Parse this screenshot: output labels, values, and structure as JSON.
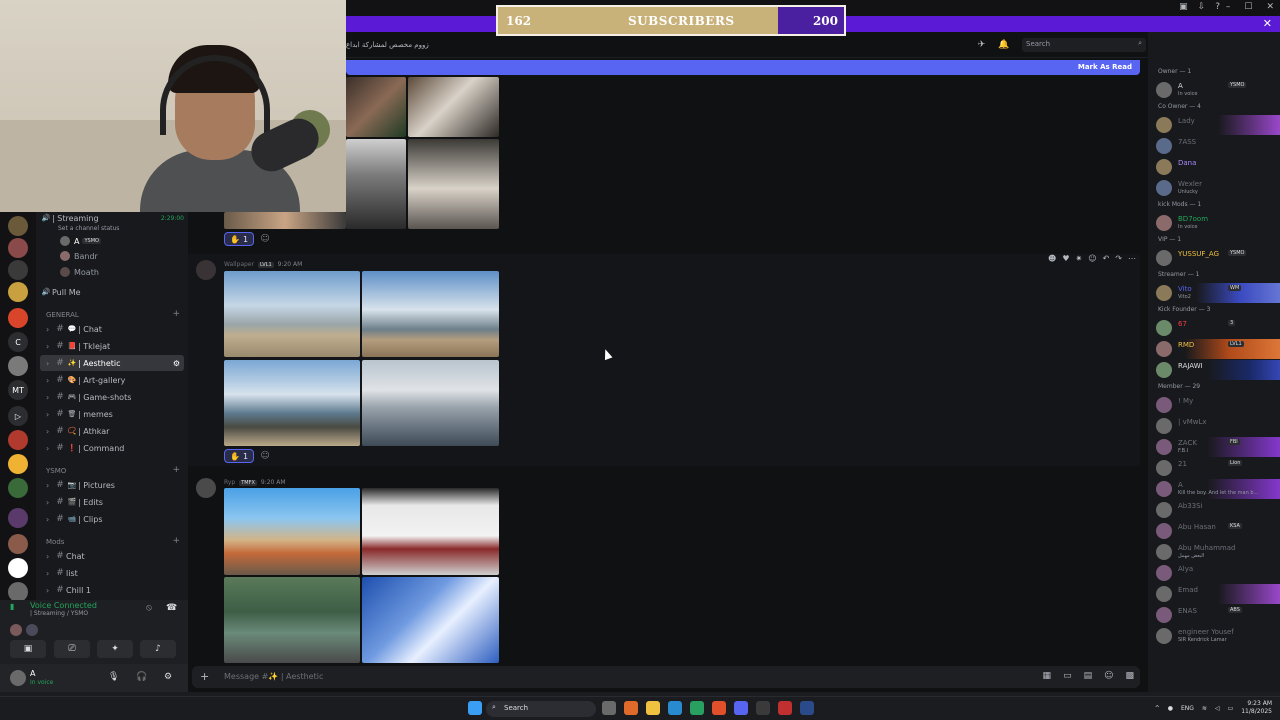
{
  "overlay": {
    "current": "162",
    "label": "SUBSCRIBERS",
    "goal": "200",
    "progress": 0.81
  },
  "sidebar": {
    "voice_channel": "| Streaming",
    "voice_time": "2:29:00",
    "status_line": "Set a channel status",
    "voice_users": [
      "A",
      "Bandr",
      "Moath"
    ],
    "voice_user_badge": "YSMO",
    "pull_me": "Pull Me",
    "cat_general": "GENERAL",
    "general_channels": [
      {
        "name": "| Chat",
        "emoji": "💬"
      },
      {
        "name": "| Tklejat",
        "emoji": "📕"
      },
      {
        "name": "| Aesthetic",
        "emoji": "✨"
      },
      {
        "name": "| Art-gallery",
        "emoji": "🎨"
      },
      {
        "name": "| Game-shots",
        "emoji": "🎮"
      },
      {
        "name": "| memes",
        "emoji": "🗑"
      },
      {
        "name": "| Athkar",
        "emoji": "📿"
      },
      {
        "name": "| Command",
        "emoji": "❗"
      }
    ],
    "cat_ysmo": "YSMO",
    "ysmo_channels": [
      {
        "name": "| Pictures",
        "emoji": "📷"
      },
      {
        "name": "| Edits",
        "emoji": "🎬"
      },
      {
        "name": "| Clips",
        "emoji": "📹"
      }
    ],
    "cat_mods": "Mods",
    "mods_channels": [
      "Chat",
      "list",
      "Chill 1"
    ]
  },
  "voice": {
    "status": "Voice Connected",
    "detail": "| Streaming / YSMO"
  },
  "user": {
    "name": "A",
    "status": "In voice"
  },
  "header": {
    "topic": "زووم مخصص لمشاركة ابداع",
    "search_placeholder": "Search"
  },
  "banner": {
    "mark_read": "Mark As Read"
  },
  "messages": [
    {
      "reaction_count": "1"
    },
    {
      "author": "Wallpaper",
      "badge": "LVL1",
      "time": "9:20 AM",
      "reaction_count": "1"
    },
    {
      "author": "Ryp",
      "badge": "TMFX",
      "time": "9:20 AM"
    }
  ],
  "composer": {
    "placeholder": "Message #✨ | Aesthetic"
  },
  "members": {
    "cat_owner": "Owner — 1",
    "owner": {
      "name": "A",
      "badge": "YSMO",
      "sub": "In voice"
    },
    "cat_co_owner": "Co Owner — 4",
    "co_owners": [
      {
        "name": "Lady",
        "sub": ""
      },
      {
        "name": "7ASS",
        "sub": ""
      },
      {
        "name": "Dana",
        "sub": ""
      },
      {
        "name": "Wexler",
        "sub": "Unlucky"
      }
    ],
    "cat_kick_mods": "kick Mods — 1",
    "kick_mod": {
      "name": "BD7oom",
      "sub": "In voice"
    },
    "cat_vip": "VIP — 1",
    "vip": {
      "name": "YUSSUF_AG",
      "badge": "YSMO"
    },
    "cat_streamer": "Streamer — 1",
    "streamer": {
      "name": "Vito",
      "badge": "WM",
      "sub": "Vito2"
    },
    "cat_kick_founder": "Kick Founder — 3",
    "kick_founders": [
      {
        "name": "67",
        "badge": "3"
      },
      {
        "name": "RMD",
        "badge": "LVL1"
      },
      {
        "name": "RAJAWI",
        "badge": ""
      }
    ],
    "cat_member": "Member — 29",
    "members_list": [
      {
        "name": "! My",
        "sub": ""
      },
      {
        "name": "| vMwLx",
        "sub": ""
      },
      {
        "name": "ZACK",
        "badge": "FBI",
        "sub": "F.B.I"
      },
      {
        "name": "21",
        "badge": "Lion",
        "sub": ""
      },
      {
        "name": "A",
        "sub": "Kill the boy. And let the man b..."
      },
      {
        "name": "Ab33Si",
        "sub": ""
      },
      {
        "name": "Abu Hasan",
        "badge": "KSA",
        "sub": ""
      },
      {
        "name": "Abu Muhammad",
        "sub": "البعض مهمل"
      },
      {
        "name": "Alya",
        "sub": ""
      },
      {
        "name": "Emad",
        "sub": ""
      },
      {
        "name": "ENAS",
        "badge": "ABS",
        "sub": ""
      },
      {
        "name": "engineer Yousef",
        "sub": "SIR Kendrick Lamar"
      }
    ]
  },
  "taskbar": {
    "search": "Search",
    "lang": "ENG",
    "time": "9:23 AM",
    "date": "11/8/2025"
  },
  "colors": {
    "blurple": "#5865f2",
    "purple_bar": "#5b1bd6",
    "gold": "#c9b27a"
  }
}
